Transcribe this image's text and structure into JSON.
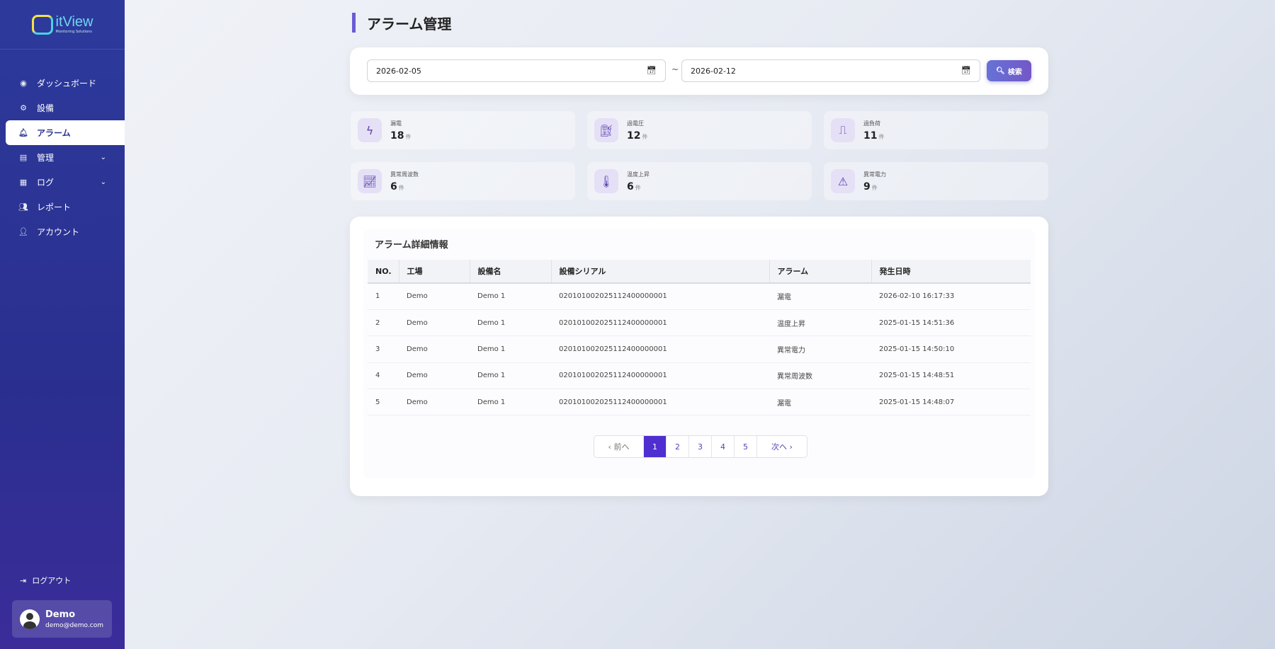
{
  "app": {
    "logo_text": "itView",
    "logo_sub": "Monitoring Solutions"
  },
  "sidebar": {
    "items": [
      {
        "label": "ダッシュボード",
        "icon": "dashboard-icon"
      },
      {
        "label": "設備",
        "icon": "gear-icon"
      },
      {
        "label": "アラーム",
        "icon": "bell-icon",
        "active": true
      },
      {
        "label": "管理",
        "icon": "book-icon",
        "expandable": true
      },
      {
        "label": "ログ",
        "icon": "calendar-icon",
        "expandable": true
      },
      {
        "label": "レポート",
        "icon": "users-icon"
      },
      {
        "label": "アカウント",
        "icon": "user-gear-icon"
      }
    ],
    "logout": "ログアウト",
    "user": {
      "name": "Demo",
      "email": "demo@demo.com"
    }
  },
  "page": {
    "title": "アラーム管理"
  },
  "search": {
    "start_date": "2026-02-05",
    "separator": "~",
    "end_date": "2026-02-12",
    "button": "検索"
  },
  "stats": [
    {
      "label": "漏電",
      "value": "18",
      "unit": "件",
      "icon": "bolt-icon"
    },
    {
      "label": "過電圧",
      "value": "12",
      "unit": "件",
      "icon": "charging-station-icon"
    },
    {
      "label": "過負荷",
      "value": "11",
      "unit": "件",
      "icon": "wave-square-icon"
    },
    {
      "label": "異常周波数",
      "value": "6",
      "unit": "件",
      "icon": "chart-line-icon"
    },
    {
      "label": "温度上昇",
      "value": "6",
      "unit": "件",
      "icon": "thermometer-icon"
    },
    {
      "label": "異常電力",
      "value": "9",
      "unit": "件",
      "icon": "warning-icon"
    }
  ],
  "detail": {
    "title": "アラーム詳細情報",
    "columns": [
      "NO.",
      "工場",
      "設備名",
      "設備シリアル",
      "アラーム",
      "発生日時"
    ],
    "rows": [
      [
        "1",
        "Demo",
        "Demo 1",
        "020101002025112400000001",
        "漏電",
        "2026-02-10 16:17:33"
      ],
      [
        "2",
        "Demo",
        "Demo 1",
        "020101002025112400000001",
        "温度上昇",
        "2025-01-15 14:51:36"
      ],
      [
        "3",
        "Demo",
        "Demo 1",
        "020101002025112400000001",
        "異常電力",
        "2025-01-15 14:50:10"
      ],
      [
        "4",
        "Demo",
        "Demo 1",
        "020101002025112400000001",
        "異常周波数",
        "2025-01-15 14:48:51"
      ],
      [
        "5",
        "Demo",
        "Demo 1",
        "020101002025112400000001",
        "漏電",
        "2025-01-15 14:48:07"
      ]
    ]
  },
  "pagination": {
    "prev": "前へ",
    "pages": [
      "1",
      "2",
      "3",
      "4",
      "5"
    ],
    "current": "1",
    "next": "次へ"
  }
}
